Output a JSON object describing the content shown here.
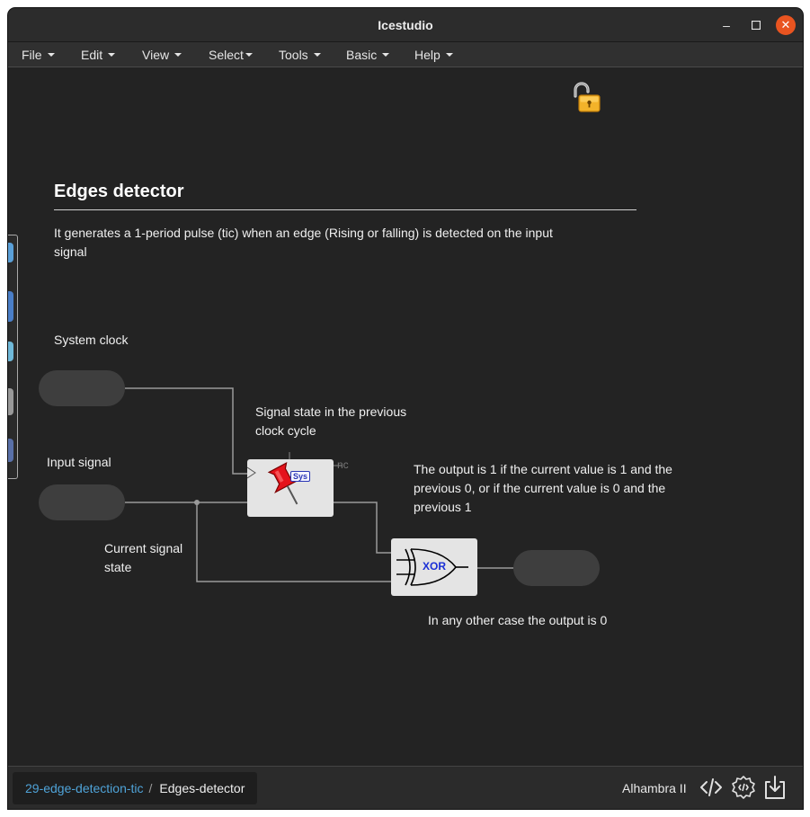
{
  "window": {
    "title": "Icestudio"
  },
  "menu": [
    {
      "label": "File"
    },
    {
      "label": "Edit"
    },
    {
      "label": "View"
    },
    {
      "label": "Select"
    },
    {
      "label": "Tools"
    },
    {
      "label": "Basic"
    },
    {
      "label": "Help"
    }
  ],
  "canvas": {
    "heading": "Edges detector",
    "description": "It generates a 1-period pulse (tic) when an edge (Rising or falling) is detected on the input signal",
    "labels": {
      "system_clock": "System clock",
      "input_signal": "Input signal",
      "prev_state": "Signal state in the previous clock cycle",
      "current_state": "Current signal state",
      "output_rule": "The output is 1 if the current value is 1 and the previous 0, or if the current value is 0 and the previous 1",
      "other_case": "In any other case the output is 0"
    },
    "blocks": {
      "sys_tag": "Sys",
      "nc": "nc",
      "xor": "XOR"
    }
  },
  "bottom": {
    "breadcrumb_project": "29-edge-detection-tic",
    "breadcrumb_sep": "/",
    "breadcrumb_current": "Edges-detector",
    "board": "Alhambra II"
  },
  "icons": [
    "lock-open-icon",
    "code-icon",
    "verify-icon",
    "upload-icon",
    "minimize-icon",
    "maximize-icon",
    "close-icon"
  ],
  "colors": {
    "accent_close": "#e95420",
    "link": "#4fa3d8",
    "canvas": "#232323"
  }
}
